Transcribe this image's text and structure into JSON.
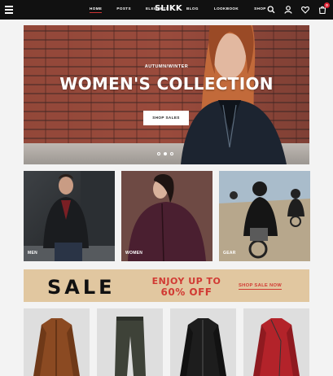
{
  "header": {
    "logo": "SLIKK",
    "nav_left": [
      "HOME",
      "POSTS",
      "ELEMENTS"
    ],
    "nav_right": [
      "BLOG",
      "LOOKBOOK",
      "SHOP"
    ],
    "active": "HOME",
    "cart_count": "0",
    "icons": [
      "menu-icon",
      "search-icon",
      "user-icon",
      "heart-icon",
      "cart-icon"
    ]
  },
  "hero": {
    "supertitle": "AUTUMN/WINTER",
    "title": "WOMEN'S COLLECTION",
    "button": "SHOP SALES",
    "slides": 3,
    "active_slide": 2
  },
  "categories": [
    {
      "label": "MEN"
    },
    {
      "label": "WOMEN"
    },
    {
      "label": "GEAR"
    }
  ],
  "sale": {
    "big": "SALE",
    "line1": "ENJOY UP TO",
    "line2": "60% OFF",
    "link": "SHOP SALE NOW"
  },
  "colors": {
    "accent": "#d13a33",
    "header_bg": "#111111",
    "banner_bg": "#e1c7a0"
  }
}
